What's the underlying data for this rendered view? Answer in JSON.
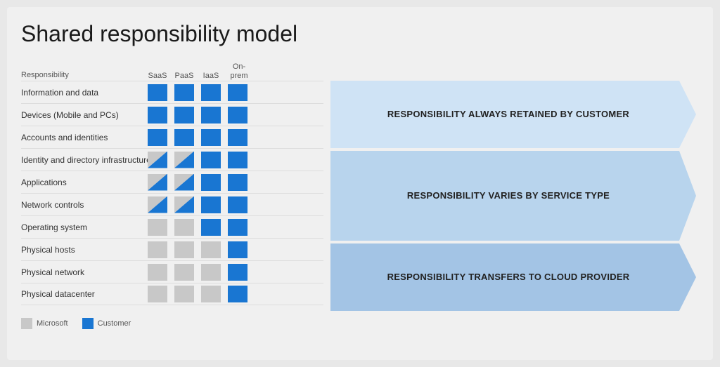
{
  "title": "Shared responsibility model",
  "columns": {
    "responsibility": "Responsibility",
    "saas": "SaaS",
    "paas": "PaaS",
    "iaas": "IaaS",
    "onprem": "On-prem"
  },
  "rows": [
    {
      "label": "Information and data",
      "saas": "blue",
      "paas": "blue",
      "iaas": "blue",
      "onprem": "blue"
    },
    {
      "label": "Devices (Mobile and PCs)",
      "saas": "blue",
      "paas": "blue",
      "iaas": "blue",
      "onprem": "blue"
    },
    {
      "label": "Accounts and identities",
      "saas": "blue",
      "paas": "blue",
      "iaas": "blue",
      "onprem": "blue"
    },
    {
      "label": "Identity and directory infrastructure",
      "saas": "split",
      "paas": "split",
      "iaas": "blue",
      "onprem": "blue"
    },
    {
      "label": "Applications",
      "saas": "split",
      "paas": "split",
      "iaas": "blue",
      "onprem": "blue"
    },
    {
      "label": "Network controls",
      "saas": "split",
      "paas": "split",
      "iaas": "blue",
      "onprem": "blue"
    },
    {
      "label": "Operating system",
      "saas": "gray",
      "paas": "gray",
      "iaas": "blue",
      "onprem": "blue"
    },
    {
      "label": "Physical hosts",
      "saas": "gray",
      "paas": "gray",
      "iaas": "gray",
      "onprem": "blue"
    },
    {
      "label": "Physical network",
      "saas": "gray",
      "paas": "gray",
      "iaas": "gray",
      "onprem": "blue"
    },
    {
      "label": "Physical datacenter",
      "saas": "gray",
      "paas": "gray",
      "iaas": "gray",
      "onprem": "blue"
    }
  ],
  "arrows": [
    {
      "text": "RESPONSIBILITY ALWAYS RETAINED BY CUSTOMER",
      "rows": 3,
      "color": "#cfe3f5"
    },
    {
      "text": "RESPONSIBILITY VARIES BY SERVICE TYPE",
      "rows": 4,
      "color": "#b8d4ed"
    },
    {
      "text": "RESPONSIBILITY TRANSFERS TO CLOUD PROVIDER",
      "rows": 3,
      "color": "#a3c4e5"
    }
  ],
  "legend": {
    "microsoft_label": "Microsoft",
    "customer_label": "Customer"
  }
}
